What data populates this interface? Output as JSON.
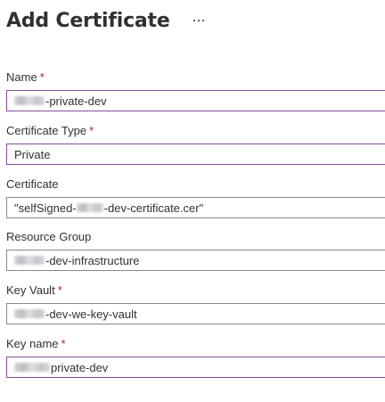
{
  "header": {
    "title": "Add Certificate",
    "more_icon": "ellipsis-icon"
  },
  "fields": {
    "name": {
      "label": "Name",
      "required": "*",
      "value_redacted_prefix": true,
      "value": "-private-dev"
    },
    "certificate_type": {
      "label": "Certificate Type",
      "required": "*",
      "value": "Private"
    },
    "certificate": {
      "label": "Certificate",
      "value_prefix": "\"selfSigned-",
      "value_suffix": "-dev-certificate.cer\""
    },
    "resource_group": {
      "label": "Resource Group",
      "value": "-dev-infrastructure"
    },
    "key_vault": {
      "label": "Key Vault",
      "required": "*",
      "value": "-dev-we-key-vault"
    },
    "key_name": {
      "label": "Key name",
      "required": "*",
      "value": "private-dev"
    }
  },
  "colors": {
    "required": "#a4262c",
    "accent_border": "#8a4d9f",
    "text": "#323130"
  }
}
